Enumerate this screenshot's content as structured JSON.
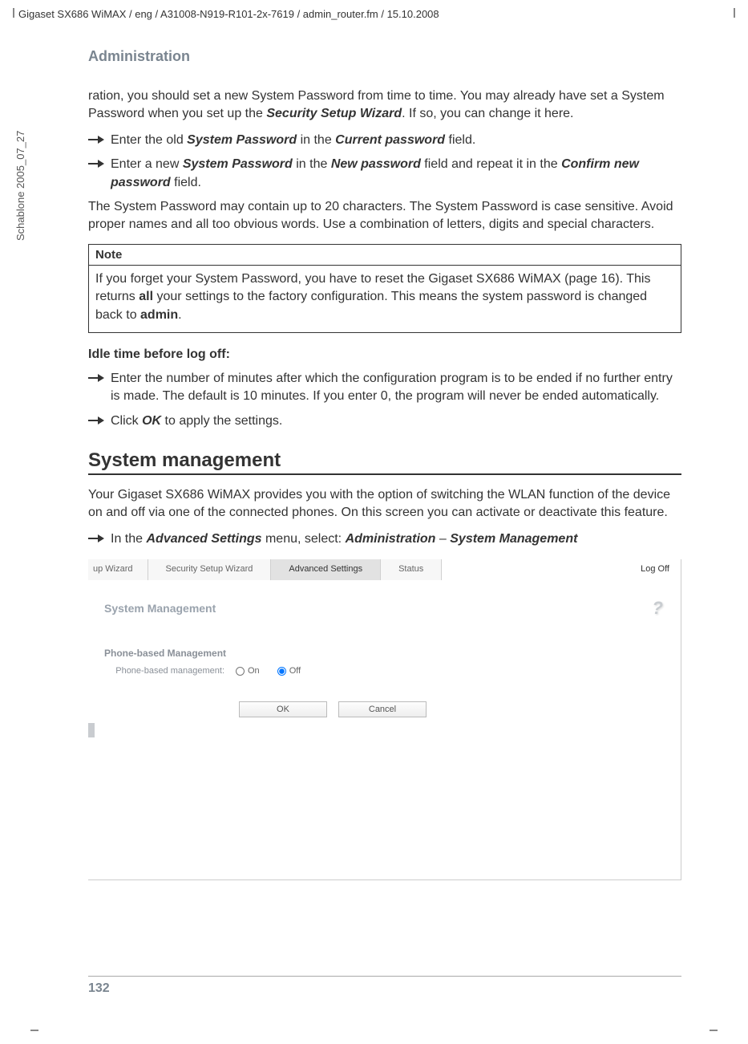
{
  "header_path": "Gigaset SX686 WiMAX / eng / A31008-N919-R101-2x-7619 / admin_router.fm / 15.10.2008",
  "sidebar_text": "Schablone 2005_07_27",
  "section_title": "Administration",
  "intro_para": "ration, you should set a new System Password from time to time. You may already have set a System Password when you set up the ",
  "intro_bold": "Security Setup Wizard",
  "intro_tail": ". If so, you can change it here.",
  "b1_a": "Enter the old ",
  "b1_b": "System Password",
  "b1_c": " in the ",
  "b1_d": "Current password",
  "b1_e": " field.",
  "b2_a": "Enter a new ",
  "b2_b": "System Password",
  "b2_c": " in the ",
  "b2_d": "New password",
  "b2_e": " field and repeat it in the ",
  "b2_f": "Confirm new password",
  "b2_g": " field.",
  "para2": "The System Password may contain up to 20 characters. The System Password is case sensitive. Avoid proper names and all too obvious words. Use a combination of letters, digits and special characters.",
  "note_label": "Note",
  "note_a": "If you forget your System Password, you have to reset the Gigaset SX686 WiMAX (page 16). This returns ",
  "note_b": "all",
  "note_c": " your settings to the factory configuration. This means the system password is changed back to ",
  "note_d": "admin",
  "note_e": ".",
  "idle_heading": "Idle time before log off:",
  "b3": "Enter the number of minutes after which the configuration program is to be ended if no further entry is made. The default is 10 minutes. If you enter 0, the program will never be ended automatically.",
  "b4_a": "Click ",
  "b4_b": "OK",
  "b4_c": " to apply the settings.",
  "h2": "System management",
  "h2_para": "Your Gigaset SX686 WiMAX provides you with the option of switching the WLAN function of the device on and off via one of the connected phones. On this screen you can activate or deactivate this feature.",
  "b5_a": "In the ",
  "b5_b": "Advanced Settings",
  "b5_c": " menu, select: ",
  "b5_d": "Administration",
  "b5_e": " – ",
  "b5_f": "System Management",
  "ss": {
    "tabs": {
      "t0": "up Wizard",
      "t1": "Security Setup Wizard",
      "t2": "Advanced Settings",
      "t3": "Status"
    },
    "logoff": "Log Off",
    "title": "System Management",
    "help": "?",
    "group": "Phone-based Management",
    "field_label": "Phone-based management:",
    "on": "On",
    "off": "Off",
    "ok": "OK",
    "cancel": "Cancel"
  },
  "page_number": "132"
}
